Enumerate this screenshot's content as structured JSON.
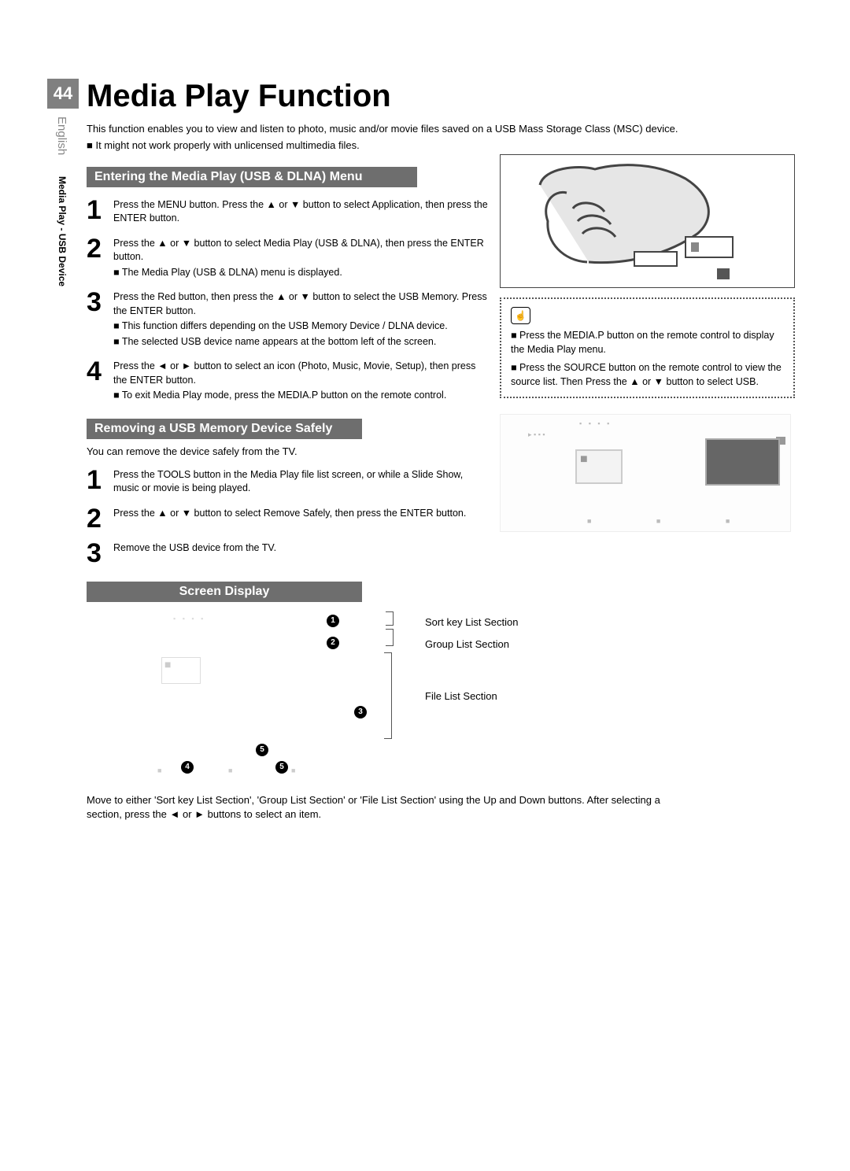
{
  "page_number": "44",
  "side_label_1": "English",
  "side_label_2": "Media Play - USB Device",
  "title": "Media Play Function",
  "intro_line1": "This function enables you to view and listen to photo, music and/or movie files saved on a USB Mass Storage Class (MSC) device.",
  "intro_bullet": "It might not work properly with unlicensed multimedia files.",
  "section1_title": "Entering the Media Play (USB & DLNA) Menu",
  "s1": {
    "step1": "Press the MENU button. Press the ▲ or ▼ button to select Application, then press the ENTER button.",
    "step2": "Press the ▲ or ▼ button to select Media Play (USB & DLNA), then press the ENTER button.",
    "step2_sub": "The Media Play (USB & DLNA) menu is displayed.",
    "step3_a": "Press the Red button, then press the ▲ or ▼ button to select the USB Memory. Press the ENTER button.",
    "step3_b": "This function differs depending on the USB Memory Device / DLNA device.",
    "step3_c": "The selected USB device name appears at the bottom left of the screen.",
    "step4_a": "Press the ◄ or ► button to select an icon (Photo, Music, Movie, Setup), then press the ENTER button.",
    "step4_b": "To exit Media Play mode, press the MEDIA.P button on the remote control."
  },
  "note1_a": "Press the MEDIA.P button on the remote control to display the Media Play menu.",
  "note1_b": "Press the SOURCE button on the remote control to view the source list. Then Press the ▲ or ▼ button to select USB.",
  "section2_title": "Removing a USB Memory Device Safely",
  "s2_intro": "You can remove the device safely from the TV.",
  "s2": {
    "step1": "Press the TOOLS button in the Media Play file list screen, or while a Slide Show, music or movie is being played.",
    "step2": "Press the ▲ or ▼ button to select Remove Safely, then press the ENTER button.",
    "step3": "Remove the USB device from the TV."
  },
  "section3_title": "Screen Display",
  "legend1": "Sort key List Section",
  "legend2": "Group List Section",
  "legend3": "File List Section",
  "final_para": "Move to either 'Sort key List Section', 'Group List Section' or 'File List Section' using the Up and Down buttons. After selecting a section, press the ◄ or ► buttons to select an item."
}
